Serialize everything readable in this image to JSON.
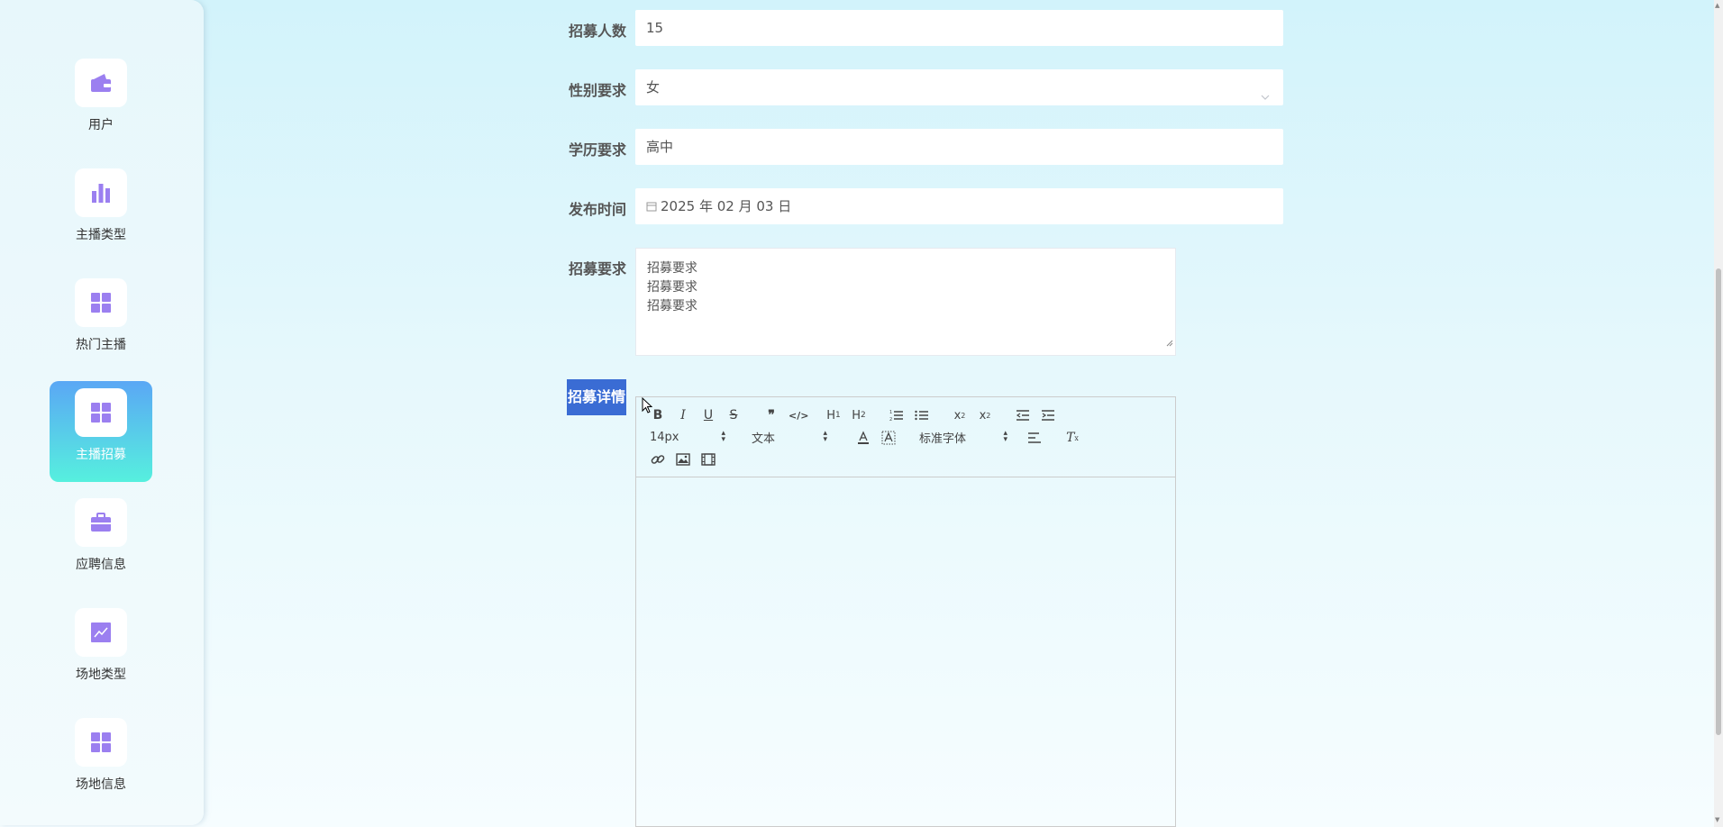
{
  "sidebar": {
    "items": [
      {
        "label": "用户",
        "icon": "wallet-icon",
        "active": false
      },
      {
        "label": "主播类型",
        "icon": "bar-chart-icon",
        "active": false
      },
      {
        "label": "热门主播",
        "icon": "grid-icon",
        "active": false
      },
      {
        "label": "主播招募",
        "icon": "grid-icon",
        "active": true
      },
      {
        "label": "应聘信息",
        "icon": "briefcase-icon",
        "active": false
      },
      {
        "label": "场地类型",
        "icon": "line-chart-icon",
        "active": false
      },
      {
        "label": "场地信息",
        "icon": "grid-icon",
        "active": false
      }
    ]
  },
  "form": {
    "recruit_count": {
      "label": "招募人数",
      "value": "15"
    },
    "gender": {
      "label": "性别要求",
      "value": "女"
    },
    "education": {
      "label": "学历要求",
      "value": "高中"
    },
    "publish_date": {
      "label": "发布时间",
      "value": "2025 年 02 月 03 日"
    },
    "requirements": {
      "label": "招募要求",
      "lines": [
        "招募要求",
        "招募要求",
        "招募要求"
      ]
    },
    "details": {
      "label": "招募详情"
    }
  },
  "editor": {
    "font_size": "14px",
    "block_type": "文本",
    "font_family": "标准字体"
  },
  "colors": {
    "accent": "#9b7ff0",
    "active_gradient_top": "#5aa7f5",
    "active_gradient_bottom": "#56f0de",
    "label_highlight": "#3a6cd4"
  }
}
